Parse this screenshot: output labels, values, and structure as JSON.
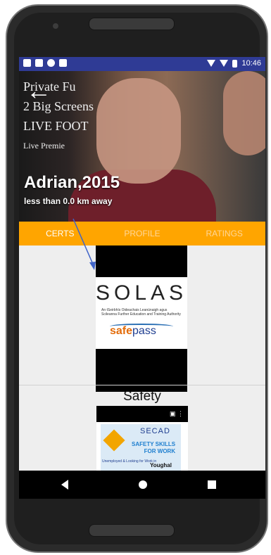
{
  "status_bar": {
    "time": "10:46",
    "left_icons": [
      "mail-icon",
      "notification-icon",
      "circle-icon",
      "sim-icon"
    ],
    "right_icons": [
      "wifi-icon",
      "signal-icon",
      "battery-icon"
    ],
    "bar_color": "#2f3b95"
  },
  "profile": {
    "name": "Adrian,2015",
    "distance": "less than 0.0 km away",
    "photo_text": {
      "line1": "Private Fu",
      "line2": "2 Big Screens",
      "line3": "LIVE FOOT",
      "line4": "Live Premie"
    }
  },
  "tabs": [
    {
      "label": "CERTS"
    },
    {
      "label": "PROFILE"
    },
    {
      "label": "RATINGS"
    }
  ],
  "tab_bar_color": "#ffa500",
  "cert": {
    "logo_title": "SOLAS",
    "logo_subtitle": "An tSeirbhís Oideachais Leanúnaigh agus Scileanna Further Education and Training Authority",
    "safepass_a": "safe",
    "safepass_b": "pass"
  },
  "safety_section": {
    "title": "Safety",
    "video_controls": "▣ ⋮",
    "card": {
      "brand": "SECAD",
      "heading_line1": "SAFETY SKILLS",
      "heading_line2": "FOR WORK",
      "note": "Unemployed & Looking for Work in",
      "town": "Youghal"
    }
  },
  "nav": {
    "back_icon": "back-triangle-icon",
    "home_icon": "home-circle-icon",
    "recent_icon": "recent-square-icon"
  }
}
